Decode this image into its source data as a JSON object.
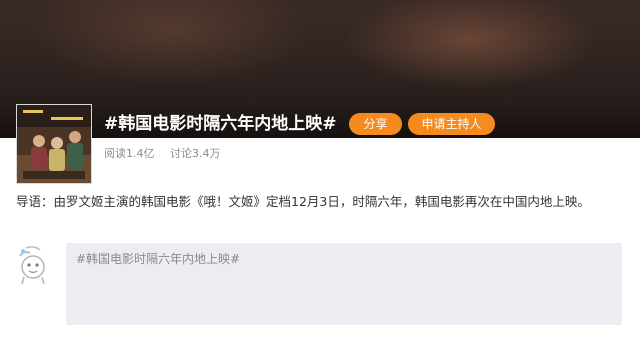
{
  "topic": {
    "title": "#韩国电影时隔六年内地上映#",
    "share_label": "分享",
    "host_label": "申请主持人"
  },
  "stats": {
    "reads": "阅读1.4亿",
    "discussions": "讨论3.4万"
  },
  "intro": {
    "text": "导语：由罗文姬主演的韩国电影《哦！文姬》定档12月3日，时隔六年，韩国电影再次在中国内地上映。"
  },
  "composer": {
    "placeholder": "#韩国电影时隔六年内地上映#"
  },
  "colors": {
    "accent": "#f58b1f",
    "banner": "#2d221f",
    "composer_bg": "#ecedf2"
  },
  "icons": {
    "avatar": "default-user-avatar-icon"
  }
}
